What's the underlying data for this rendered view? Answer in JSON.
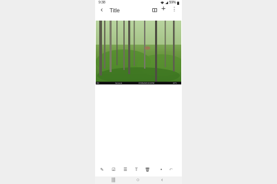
{
  "status": {
    "time": "9:38",
    "battery": "59%",
    "icons": [
      "sync-icon",
      "alarm-icon",
      "wifi-icon",
      "signal-icon",
      "battery-icon"
    ]
  },
  "appbar": {
    "back_icon": "back-arrow-icon",
    "title": "Title",
    "icons": [
      "book-icon",
      "plus-icon",
      "more-vert-icon"
    ]
  },
  "photo": {
    "overlay_text": [
      "PM",
      "Camera1",
      "07/26/2018 03:48:58",
      "18°C"
    ]
  },
  "toolbar": {
    "icons": [
      "pen-icon",
      "checkbox-icon",
      "list-icon",
      "text-format-icon",
      "delete-icon",
      "dot-icon",
      "undo-icon"
    ]
  },
  "navbar": {
    "recents": "|||",
    "home": "○",
    "back": "‹"
  }
}
